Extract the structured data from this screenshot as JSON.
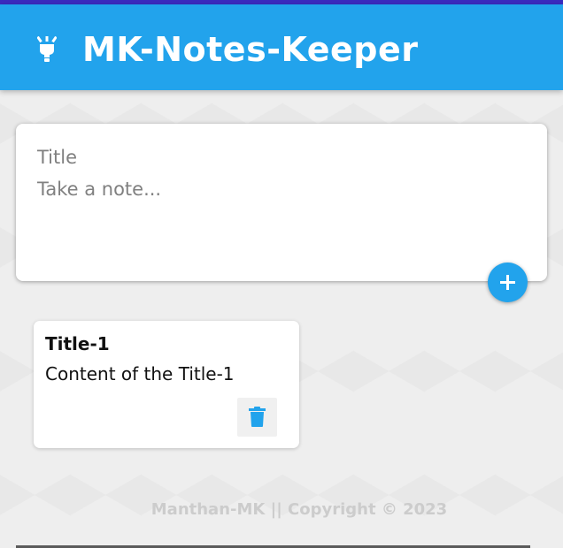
{
  "header": {
    "app_title": "MK-Notes-Keeper",
    "logo_icon": "lightbulb-icon",
    "background_color": "#22a3ec"
  },
  "create_note": {
    "title_placeholder": "Title",
    "content_placeholder": "Take a note...",
    "add_button_icon": "plus-icon"
  },
  "notes": [
    {
      "title": "Title-1",
      "content": "Content of the Title-1",
      "delete_icon": "trash-icon"
    }
  ],
  "footer": {
    "text": "Manthan-MK || Copyright © 2023"
  },
  "colors": {
    "accent": "#22a3ec",
    "top_strip": "#3b2bbf",
    "background": "#eeeeee"
  }
}
